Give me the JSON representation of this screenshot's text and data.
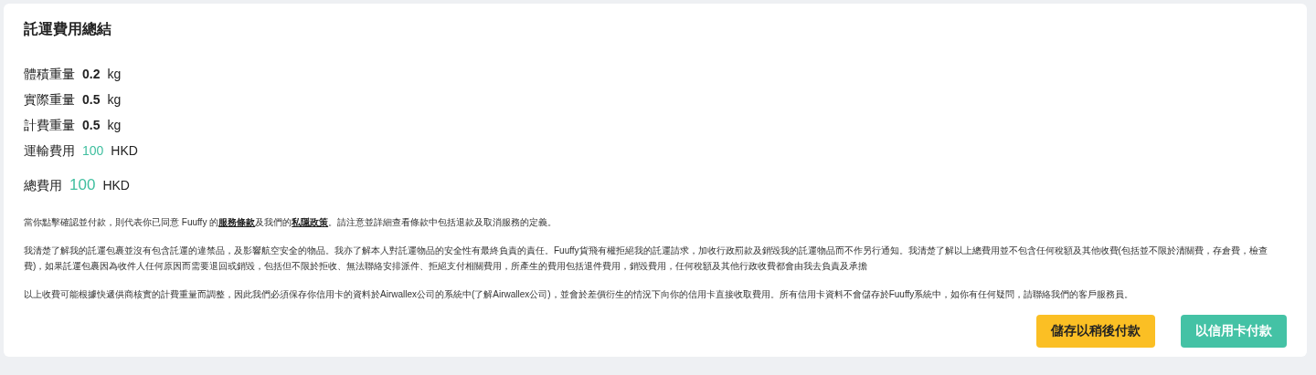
{
  "title": "託運費用總結",
  "weights": [
    {
      "label": "體積重量",
      "value": "0.2",
      "unit": "kg"
    },
    {
      "label": "實際重量",
      "value": "0.5",
      "unit": "kg"
    },
    {
      "label": "計費重量",
      "value": "0.5",
      "unit": "kg"
    }
  ],
  "fees": [
    {
      "kind": "line",
      "label": "運輸費用",
      "value": "100",
      "unit": "HKD"
    },
    {
      "kind": "total",
      "label": "總費用",
      "value": "100",
      "unit": "HKD"
    }
  ],
  "terms": [
    [
      {
        "kind": "text",
        "text": "當你點擊確認並付款，則代表你已同意 Fuuffy 的"
      },
      {
        "kind": "link",
        "text": "服務條款"
      },
      {
        "kind": "text",
        "text": "及我們的"
      },
      {
        "kind": "link",
        "text": "私隱政策"
      },
      {
        "kind": "text",
        "text": "。請注意並詳細查看條款中包括退款及取消服務的定義。"
      }
    ],
    [
      {
        "kind": "text",
        "text": "我清楚了解我的託運包裹並沒有包含託運的違禁品，及影響航空安全的物品。我亦了解本人對託運物品的安全性有最終負責的責任。Fuuffy貨飛有權拒絕我的託運請求，加收行政罰款及銷毀我的託運物品而不作另行通知。我清楚了解以上總費用並不包含任何稅額及其他收費(包括並不限於清關費，存倉費，檢查費)，如果託運包裹因為收件人任何原因而需要退回或銷毀，包括但不限於拒收、無法聯絡安排派件、拒絕支付相關費用，所產生的費用包括退件費用，銷毀費用，任何稅額及其他行政收費都會由我去負責及承擔"
      }
    ],
    [
      {
        "kind": "text",
        "text": "以上收費可能根據快遞供商核實的計費重量而調整，因此我們必須保存你信用卡的資料於Airwallex公司的系統中(了解Airwallex公司)，並會於差價衍生的情況下向你的信用卡直接收取費用。所有信用卡資料不會儲存於Fuuffy系統中，如你有任何疑問，請聯絡我們的客戶服務員。"
      }
    ]
  ],
  "buttons": [
    {
      "kind": "secondary",
      "label": "儲存以稍後付款"
    },
    {
      "kind": "primary",
      "label": "以信用卡付款"
    }
  ]
}
